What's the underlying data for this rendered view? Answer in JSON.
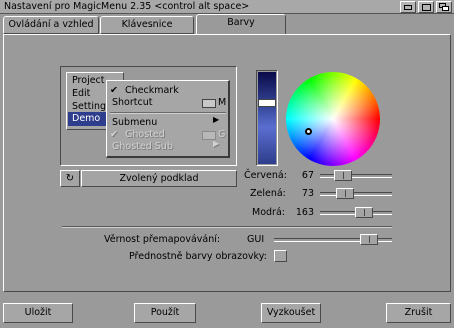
{
  "window": {
    "title": "Nastavení pro MagicMenu 2.35 <control alt space>"
  },
  "tabs": [
    {
      "label": "Ovládání a vzhled"
    },
    {
      "label": "Klávesnice"
    },
    {
      "label": "Barvy"
    }
  ],
  "active_tab": "Barvy",
  "preview": {
    "menu_items": [
      "Project",
      "Edit",
      "Settings",
      "Demo"
    ],
    "selected_item": "Demo",
    "submenu": {
      "items": [
        {
          "label": "Checkmark",
          "checked": true
        },
        {
          "label": "Shortcut",
          "shortcut": "M"
        },
        {
          "label": "Submenu",
          "has_arrow": true
        },
        {
          "label": "Ghosted",
          "shortcut": "G",
          "ghosted": true,
          "checked": true
        },
        {
          "label": "Ghosted Sub",
          "ghosted": true,
          "has_arrow": true
        }
      ]
    },
    "cycle_icon": "cycle-icon",
    "background_label": "Zvolený podklad"
  },
  "colors": {
    "red": {
      "label": "Červená:",
      "value": "67",
      "fraction": 0.26
    },
    "green": {
      "label": "Zelená:",
      "value": "73",
      "fraction": 0.29
    },
    "blue": {
      "label": "Modrá:",
      "value": "163",
      "fraction": 0.64
    },
    "brightness_fraction": 0.33,
    "swatch": "#2e3d8c"
  },
  "options": {
    "remap_label": "Věrnost přemapovávání:",
    "remap_value": "GUI",
    "remap_fraction": 0.86,
    "preferred_label": "Přednostně barvy obrazovky:",
    "preferred_checked": false
  },
  "buttons": {
    "save": "Uložit",
    "use": "Použít",
    "try": "Vyzkoušet",
    "cancel": "Zrušit"
  }
}
